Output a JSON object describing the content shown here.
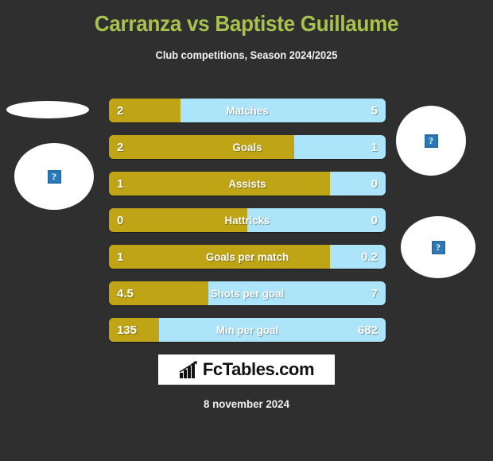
{
  "header": {
    "title": "Carranza vs Baptiste Guillaume",
    "subtitle": "Club competitions, Season 2024/2025",
    "title_color": "#a8c24c",
    "subtitle_color": "#f2f2f2"
  },
  "theme": {
    "background": "#2f2f2f",
    "home_color": "#bfa516",
    "away_color": "#ace5fa",
    "text_color": "#ffffff"
  },
  "avatars": [
    {
      "name": "home-player-photo-top",
      "placeholder": "?"
    },
    {
      "name": "home-player-photo",
      "placeholder": "?"
    },
    {
      "name": "away-player-photo",
      "placeholder": "?"
    },
    {
      "name": "away-team-logo",
      "placeholder": "?"
    }
  ],
  "chart_data": {
    "type": "bar",
    "title": "Carranza vs Baptiste Guillaume",
    "subtitle": "Club competitions, Season 2024/2025",
    "orientation": "horizontal-diverging",
    "legend": [
      "Carranza",
      "Baptiste Guillaume"
    ],
    "categories": [
      "Matches",
      "Goals",
      "Assists",
      "Hattricks",
      "Goals per match",
      "Shots per goal",
      "Min per goal"
    ],
    "series": [
      {
        "name": "Carranza",
        "values": [
          "2",
          "2",
          "1",
          "0",
          "1",
          "4.5",
          "135"
        ]
      },
      {
        "name": "Baptiste Guillaume",
        "values": [
          "5",
          "1",
          "0",
          "0",
          "0.2",
          "7",
          "682"
        ]
      }
    ],
    "home_fill_percent": [
      26,
      67,
      80,
      50,
      80,
      36,
      18
    ]
  },
  "stats": {
    "rows": [
      {
        "label": "Matches",
        "home": "2",
        "away": "5",
        "home_pct": 26
      },
      {
        "label": "Goals",
        "home": "2",
        "away": "1",
        "home_pct": 67
      },
      {
        "label": "Assists",
        "home": "1",
        "away": "0",
        "home_pct": 80
      },
      {
        "label": "Hattricks",
        "home": "0",
        "away": "0",
        "home_pct": 50
      },
      {
        "label": "Goals per match",
        "home": "1",
        "away": "0.2",
        "home_pct": 80
      },
      {
        "label": "Shots per goal",
        "home": "4.5",
        "away": "7",
        "home_pct": 36
      },
      {
        "label": "Min per goal",
        "home": "135",
        "away": "682",
        "home_pct": 18
      }
    ]
  },
  "footer": {
    "logo_text": "FcTables.com",
    "logo_icon": "bar-chart-icon",
    "date": "8 november 2024"
  }
}
